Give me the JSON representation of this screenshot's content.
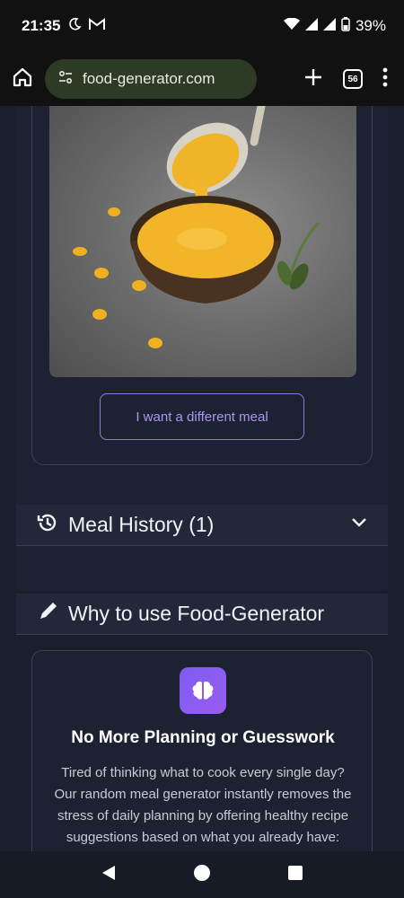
{
  "status": {
    "time": "21:35",
    "battery": "39%"
  },
  "browser": {
    "url": "food-generator.com",
    "tab_count": "56"
  },
  "meal": {
    "different_button": "I want a different meal"
  },
  "history": {
    "title": "Meal History (1)"
  },
  "why": {
    "title": "Why to use Food-Generator"
  },
  "feature": {
    "title": "No More Planning or Guesswork",
    "description": "Tired of thinking what to cook every single day? Our random meal generator instantly removes the stress of daily planning by offering healthy recipe suggestions based on what you already have: breakfast, lunch, dinner, snack, or dessert."
  },
  "colors": {
    "accent": "#8b7ae0",
    "background": "#1a1f2e"
  }
}
